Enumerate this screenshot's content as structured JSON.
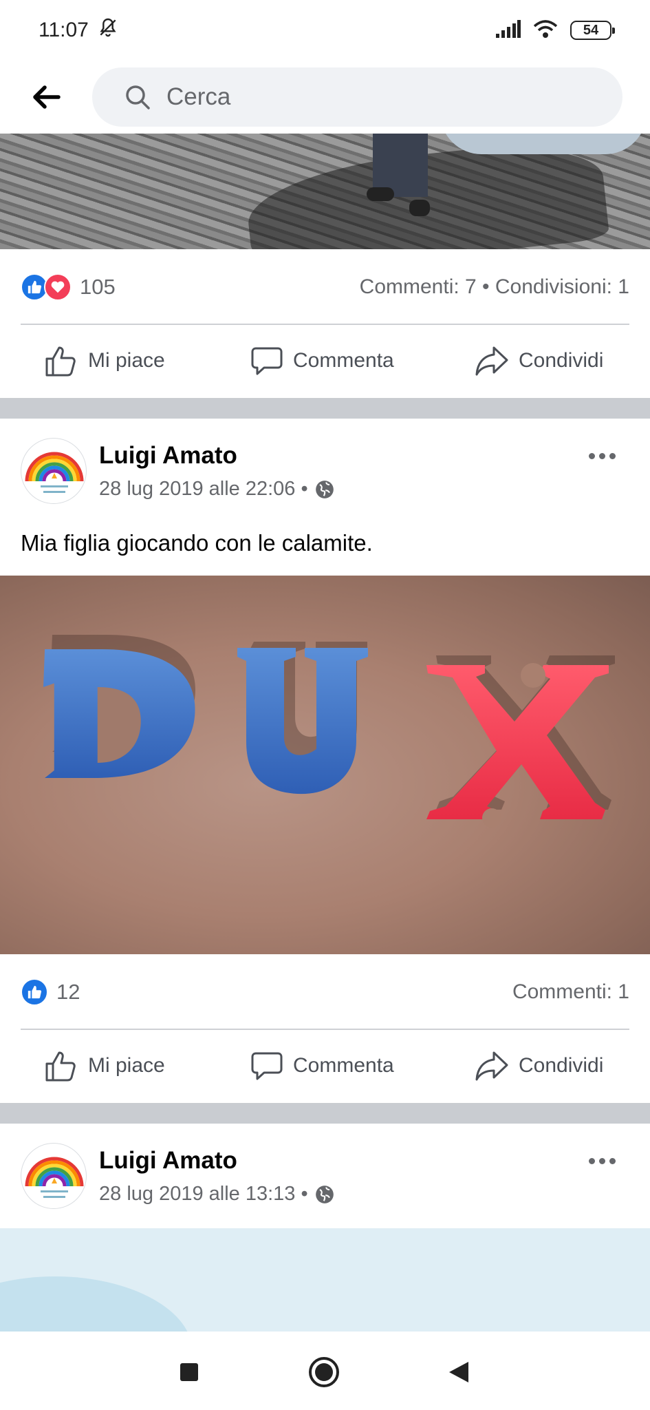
{
  "status_bar": {
    "time": "11:07",
    "battery": "54"
  },
  "search": {
    "placeholder": "Cerca"
  },
  "post1": {
    "reaction_count": "105",
    "comments_shares": "Commenti: 7 • Condivisioni: 1"
  },
  "actions": {
    "like": "Mi piace",
    "comment": "Commenta",
    "share": "Condividi"
  },
  "post2": {
    "author": "Luigi Amato",
    "timestamp": "28 lug 2019 alle 22:06 •",
    "text": "Mia figlia giocando con le calamite.",
    "image_letters": [
      "D",
      "U",
      "X"
    ],
    "reaction_count": "12",
    "comments": "Commenti: 1"
  },
  "post3": {
    "author": "Luigi Amato",
    "timestamp": "28 lug 2019 alle 13:13 •"
  },
  "colors": {
    "facebook_blue": "#1b74e4",
    "love_red": "#f33e58",
    "secondary_text": "#65676b"
  }
}
